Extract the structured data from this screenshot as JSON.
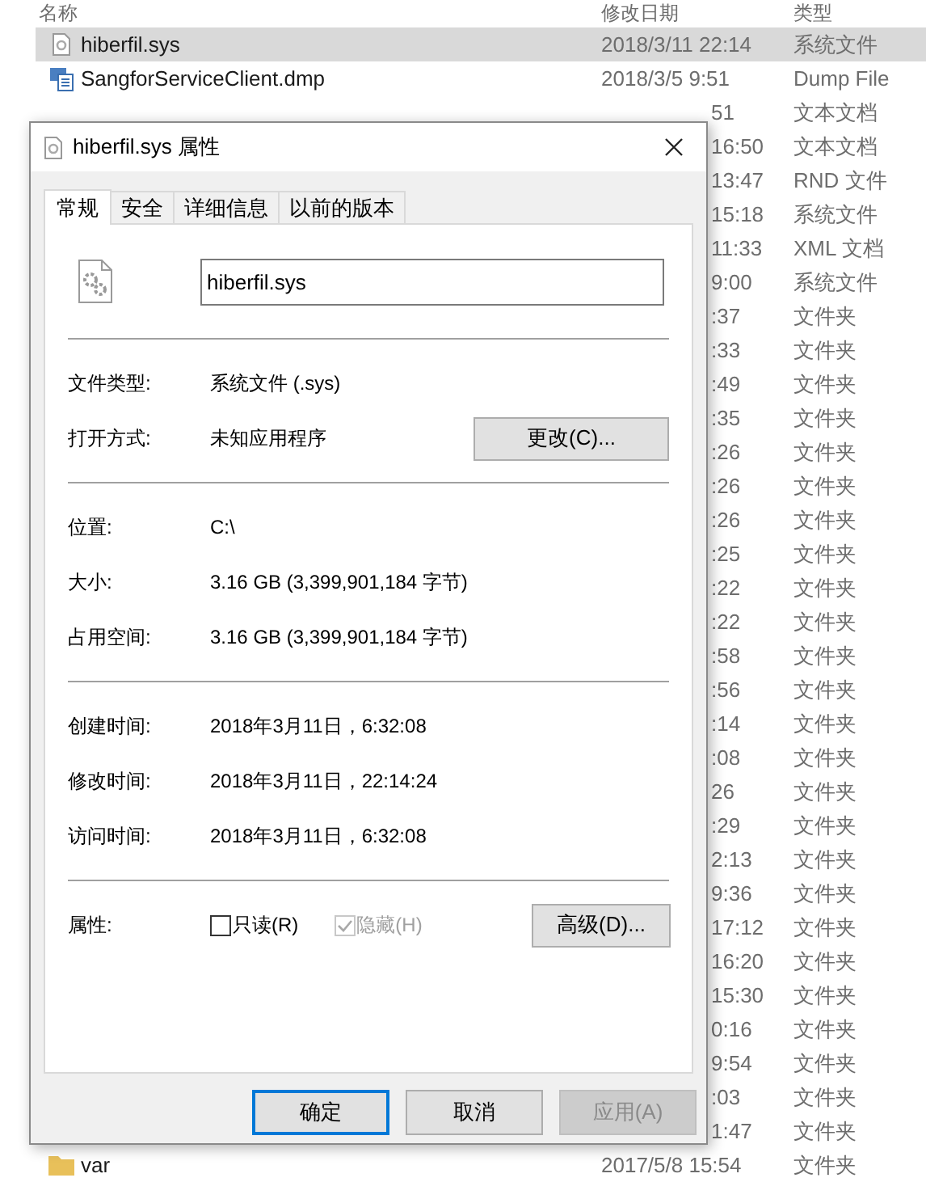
{
  "explorer": {
    "columns": [
      "名称",
      "修改日期",
      "类型"
    ],
    "rows": [
      {
        "name": "hiberfil.sys",
        "kind": "system",
        "date": "2018/3/11 22:14",
        "type": "系统文件",
        "selected": true
      },
      {
        "name": "SangforServiceClient.dmp",
        "kind": "dump",
        "date": "2018/3/5 9:51",
        "type": "Dump File",
        "selected": false
      },
      {
        "date": "51",
        "type": "文本文档",
        "selected": false
      },
      {
        "date": "16:50",
        "type": "文本文档",
        "selected": false
      },
      {
        "date": "13:47",
        "type": "RND 文件",
        "selected": false
      },
      {
        "date": "15:18",
        "type": "系统文件",
        "selected": false
      },
      {
        "date": "11:33",
        "type": "XML 文档",
        "selected": false
      },
      {
        "date": "9:00",
        "type": "系统文件",
        "selected": false
      },
      {
        "date": ":37",
        "type": "文件夹",
        "selected": false
      },
      {
        "date": ":33",
        "type": "文件夹",
        "selected": false
      },
      {
        "date": ":49",
        "type": "文件夹",
        "selected": false
      },
      {
        "date": ":35",
        "type": "文件夹",
        "selected": false
      },
      {
        "date": ":26",
        "type": "文件夹",
        "selected": false
      },
      {
        "date": ":26",
        "type": "文件夹",
        "selected": false
      },
      {
        "date": ":26",
        "type": "文件夹",
        "selected": false
      },
      {
        "date": ":25",
        "type": "文件夹",
        "selected": false
      },
      {
        "date": ":22",
        "type": "文件夹",
        "selected": false
      },
      {
        "date": ":22",
        "type": "文件夹",
        "selected": false
      },
      {
        "date": ":58",
        "type": "文件夹",
        "selected": false
      },
      {
        "date": ":56",
        "type": "文件夹",
        "selected": false
      },
      {
        "date": ":14",
        "type": "文件夹",
        "selected": false
      },
      {
        "date": ":08",
        "type": "文件夹",
        "selected": false
      },
      {
        "date": "26",
        "type": "文件夹",
        "selected": false
      },
      {
        "date": ":29",
        "type": "文件夹",
        "selected": false
      },
      {
        "date": "2:13",
        "type": "文件夹",
        "selected": false
      },
      {
        "date": "9:36",
        "type": "文件夹",
        "selected": false
      },
      {
        "date": "17:12",
        "type": "文件夹",
        "selected": false
      },
      {
        "date": "16:20",
        "type": "文件夹",
        "selected": false
      },
      {
        "date": "15:30",
        "type": "文件夹",
        "selected": false
      },
      {
        "date": "0:16",
        "type": "文件夹",
        "selected": false
      },
      {
        "date": "9:54",
        "type": "文件夹",
        "selected": false
      },
      {
        "date": ":03",
        "type": "文件夹",
        "selected": false
      },
      {
        "date": "1:47",
        "type": "文件夹",
        "selected": false
      },
      {
        "name": "var",
        "kind": "folder",
        "date": "2017/5/8 15:54",
        "type": "文件夹",
        "selected": false
      }
    ]
  },
  "dialog": {
    "title": "hiberfil.sys 属性",
    "tabs": [
      {
        "label": "常规",
        "selected": true
      },
      {
        "label": "安全",
        "selected": false
      },
      {
        "label": "详细信息",
        "selected": false
      },
      {
        "label": "以前的版本",
        "selected": false
      }
    ],
    "file_name": "hiberfil.sys",
    "sections": [
      [
        {
          "label": "文件类型:",
          "value": "系统文件 (.sys)"
        },
        {
          "label": "打开方式:",
          "value": "未知应用程序",
          "button": "更改(C)..."
        }
      ],
      [
        {
          "label": "位置:",
          "value": "C:\\"
        },
        {
          "label": "大小:",
          "value": "3.16 GB (3,399,901,184 字节)"
        },
        {
          "label": "占用空间:",
          "value": "3.16 GB (3,399,901,184 字节)"
        }
      ],
      [
        {
          "label": "创建时间:",
          "value": "2018年3月11日，6:32:08"
        },
        {
          "label": "修改时间:",
          "value": "2018年3月11日，22:14:24"
        },
        {
          "label": "访问时间:",
          "value": "2018年3月11日，6:32:08"
        }
      ]
    ],
    "attributes": {
      "label": "属性:",
      "checkboxes": [
        {
          "label": "只读(R)",
          "checked": false,
          "disabled": false
        },
        {
          "label": "隐藏(H)",
          "checked": true,
          "disabled": true
        }
      ],
      "button": "高级(D)..."
    },
    "buttons": [
      {
        "label": "确定",
        "default": true,
        "disabled": false
      },
      {
        "label": "取消",
        "default": false,
        "disabled": false
      },
      {
        "label": "应用(A)",
        "default": false,
        "disabled": true
      }
    ]
  }
}
